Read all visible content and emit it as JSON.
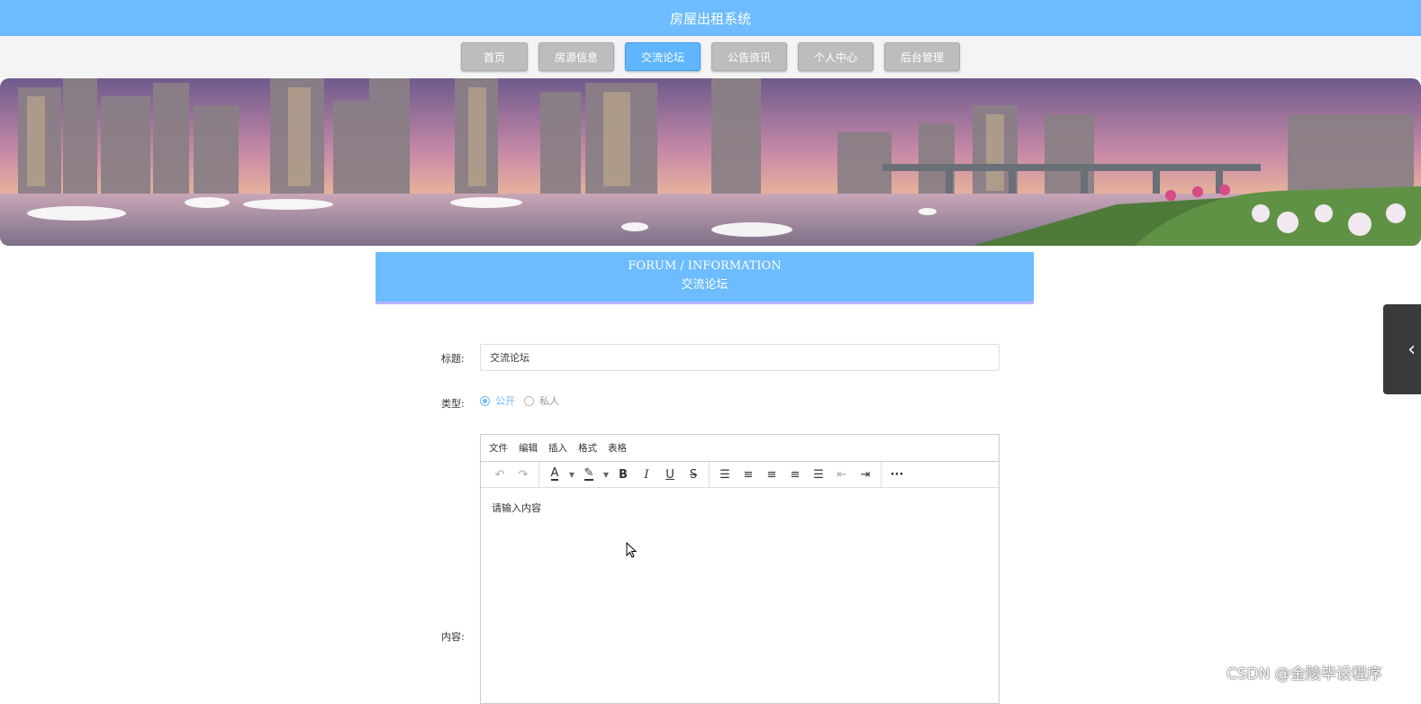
{
  "header": {
    "title": "房屋出租系统"
  },
  "nav": {
    "items": [
      {
        "label": "首页",
        "active": false
      },
      {
        "label": "房源信息",
        "active": false
      },
      {
        "label": "交流论坛",
        "active": true
      },
      {
        "label": "公告资讯",
        "active": false
      },
      {
        "label": "个人中心",
        "active": false
      },
      {
        "label": "后台管理",
        "active": false
      }
    ]
  },
  "section": {
    "title_en": "FORUM / INFORMATION",
    "title_cn": "交流论坛"
  },
  "form": {
    "title_label": "标题:",
    "title_value": "交流论坛",
    "type_label": "类型:",
    "type_options": [
      {
        "label": "公开",
        "checked": true
      },
      {
        "label": "私人",
        "checked": false
      }
    ],
    "content_label": "内容:"
  },
  "editor": {
    "menu": [
      "文件",
      "编辑",
      "插入",
      "格式",
      "表格"
    ],
    "placeholder": "请输入内容",
    "tools": [
      "undo-icon",
      "redo-icon",
      "font-color-icon",
      "highlight-icon",
      "bold-icon",
      "italic-icon",
      "underline-icon",
      "strikethrough-icon",
      "list-icon",
      "align-left-icon",
      "align-center-icon",
      "align-right-icon",
      "align-justify-icon",
      "outdent-icon",
      "indent-icon",
      "more-icon"
    ]
  },
  "colors": {
    "primary": "#6cbcff",
    "nav_inactive": "#bdbdbd",
    "accent_border": "#b9b4ff"
  },
  "watermark": "CSDN @金陵毕设程序"
}
